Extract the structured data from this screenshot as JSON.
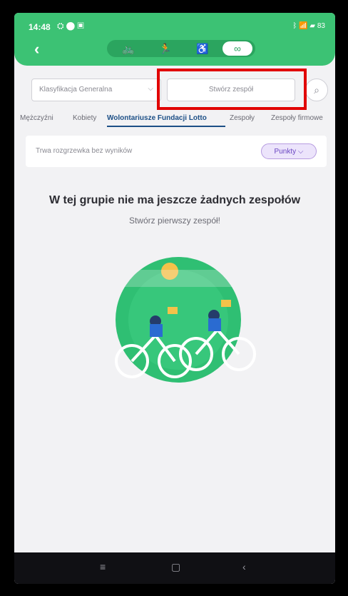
{
  "status": {
    "time": "14:48",
    "icons_left": "⛭ ⬤ ▣",
    "icons_right": "ᛒ 📶 ▰ 83"
  },
  "header": {
    "back_label": "‹",
    "sports": [
      {
        "name": "bike",
        "icon": "🚲"
      },
      {
        "name": "run",
        "icon": "🏃"
      },
      {
        "name": "wheelchair",
        "icon": "♿"
      },
      {
        "name": "link",
        "icon": "∞"
      }
    ]
  },
  "filters": {
    "dropdown_label": "Klasyfikacja Generalna",
    "create_team_label": "Stwórz zespół",
    "search_icon": "⌕"
  },
  "tabs": [
    "Mężczyźni",
    "Kobiety",
    "Wolontariusze Fundacji Lotto",
    "Zespoły",
    "Zespoły firmowe"
  ],
  "card": {
    "info": "Trwa rozgrzewka bez wyników",
    "sort_label": "Punkty ⌵"
  },
  "empty": {
    "title": "W tej grupie nie ma jeszcze żadnych zespołów",
    "subtitle": "Stwórz pierwszy zespół!"
  },
  "nav": {
    "menu": "≡",
    "home": "▢",
    "back": "‹"
  }
}
